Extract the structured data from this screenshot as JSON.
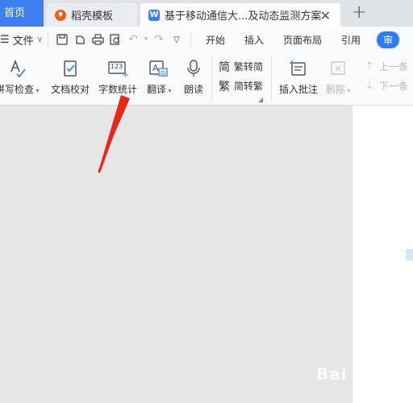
{
  "tabs": {
    "home": "首页",
    "template": "稻壳模板",
    "document": "基于移动通信大...及动态监测方案",
    "add": "+"
  },
  "menu": {
    "file": "文件",
    "tabs": [
      "开始",
      "插入",
      "页面布局",
      "引用",
      "审"
    ]
  },
  "ribbon": {
    "spell_check": "拼写检查",
    "doc_proofread": "文档校对",
    "word_count": "字数统计",
    "word_count_icon_text": "123",
    "translate": "翻译",
    "read_aloud": "朗读",
    "to_traditional": "繁转简",
    "to_simplified": "简转繁",
    "insert_comment": "插入批注",
    "delete": "删除",
    "prev": "上一条",
    "next": "下一条"
  },
  "watermark": "Bai 经验",
  "colors": {
    "accent": "#3d7ef0",
    "arrow": "#e8261c"
  }
}
